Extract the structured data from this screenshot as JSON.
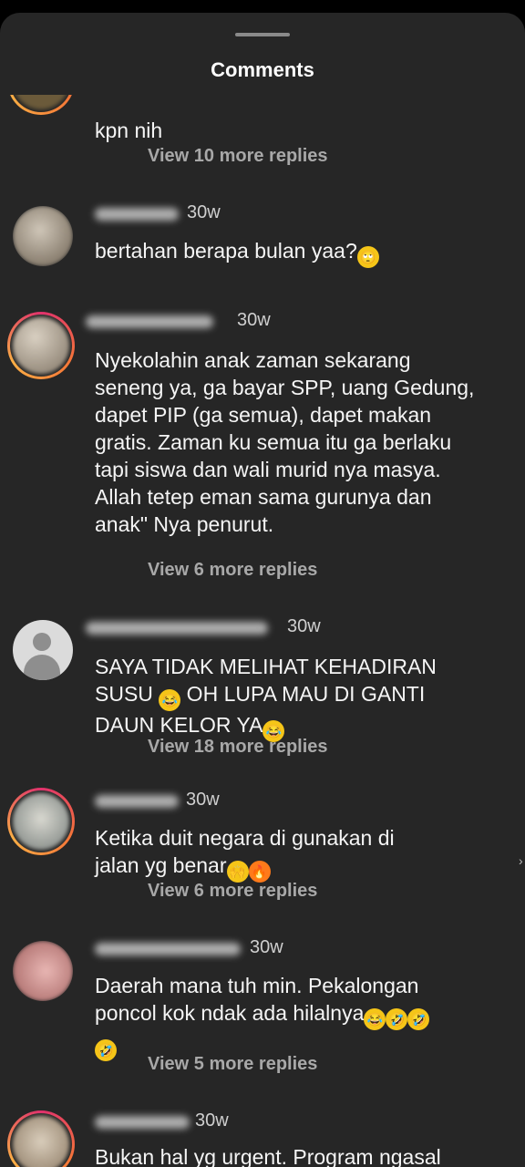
{
  "header": {
    "title": "Comments"
  },
  "comments": [
    {
      "text": "kpn nih",
      "replies": "View 10 more replies"
    },
    {
      "time": "30w",
      "text": "bertahan berapa bulan yaa?",
      "emoji": "🙄"
    },
    {
      "time": "30w",
      "text": "Nyekolahin anak zaman sekarang seneng ya, ga bayar SPP, uang Gedung, dapet PIP (ga semua), dapet makan gratis. Zaman ku semua itu ga berlaku tapi siswa dan wali murid nya masya. Allah tetep  eman sama gurunya dan anak\" Nya penurut.",
      "replies": "View 6 more replies"
    },
    {
      "time": "30w",
      "line1": "SAYA TIDAK MELIHAT KEHADIRAN",
      "line2": "SUSU",
      "line2b": " OH LUPA MAU DI GANTI",
      "line3": "DAUN KELOR YA",
      "emoji": "😂",
      "replies": "View 18 more replies"
    },
    {
      "time": "30w",
      "line1": "Ketika duit negara di gunakan di",
      "line2": "jalan yg benar",
      "emoji1": "🙌",
      "emoji2": "🔥",
      "replies": "View 6 more replies"
    },
    {
      "time": "30w",
      "line1": "Daerah mana tuh min. Pekalongan",
      "line2": "poncol kok ndak ada hilalnya",
      "emoji1": "😂",
      "emoji2": "🤣",
      "replies": "View 5 more replies"
    },
    {
      "time": "30w",
      "text": "Bukan hal yg urgent. Program ngasal"
    }
  ],
  "colors": {
    "background": "#262626",
    "text": "#f5f5f5",
    "muted": "#a8a8a8",
    "ring": "#e1306c"
  }
}
